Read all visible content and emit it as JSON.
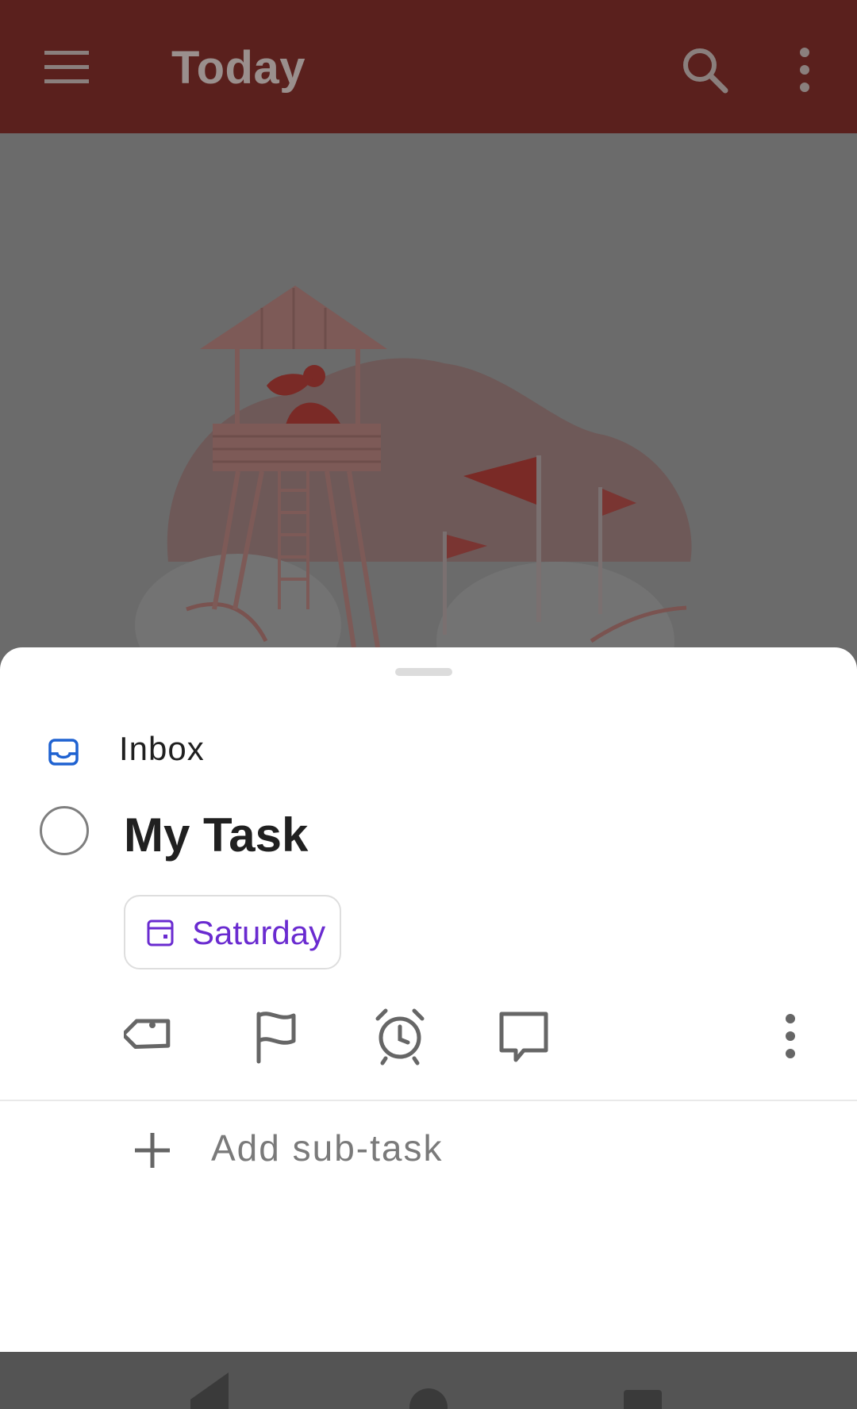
{
  "appbar": {
    "title": "Today",
    "icons": {
      "menu": "hamburger-menu-icon",
      "search": "search-icon",
      "more": "more-vert-icon"
    }
  },
  "sheet": {
    "project": {
      "label": "Inbox",
      "icon": "inbox-icon",
      "color": "#1f62d1"
    },
    "task": {
      "title": "My Task",
      "completed": false
    },
    "due_date": {
      "label": "Saturday",
      "icon": "calendar-icon",
      "color": "#6a2bd0"
    },
    "actions": [
      {
        "name": "label-tag-icon"
      },
      {
        "name": "priority-flag-icon"
      },
      {
        "name": "reminder-alarm-icon"
      },
      {
        "name": "comment-icon"
      },
      {
        "name": "more-vert-icon"
      }
    ],
    "subtask": {
      "label": "Add sub-task",
      "icon": "plus-icon"
    }
  },
  "colors": {
    "appbar": "#5a201d",
    "scrim_bg": "#6b6b6b",
    "accent": "#db4c3f"
  }
}
